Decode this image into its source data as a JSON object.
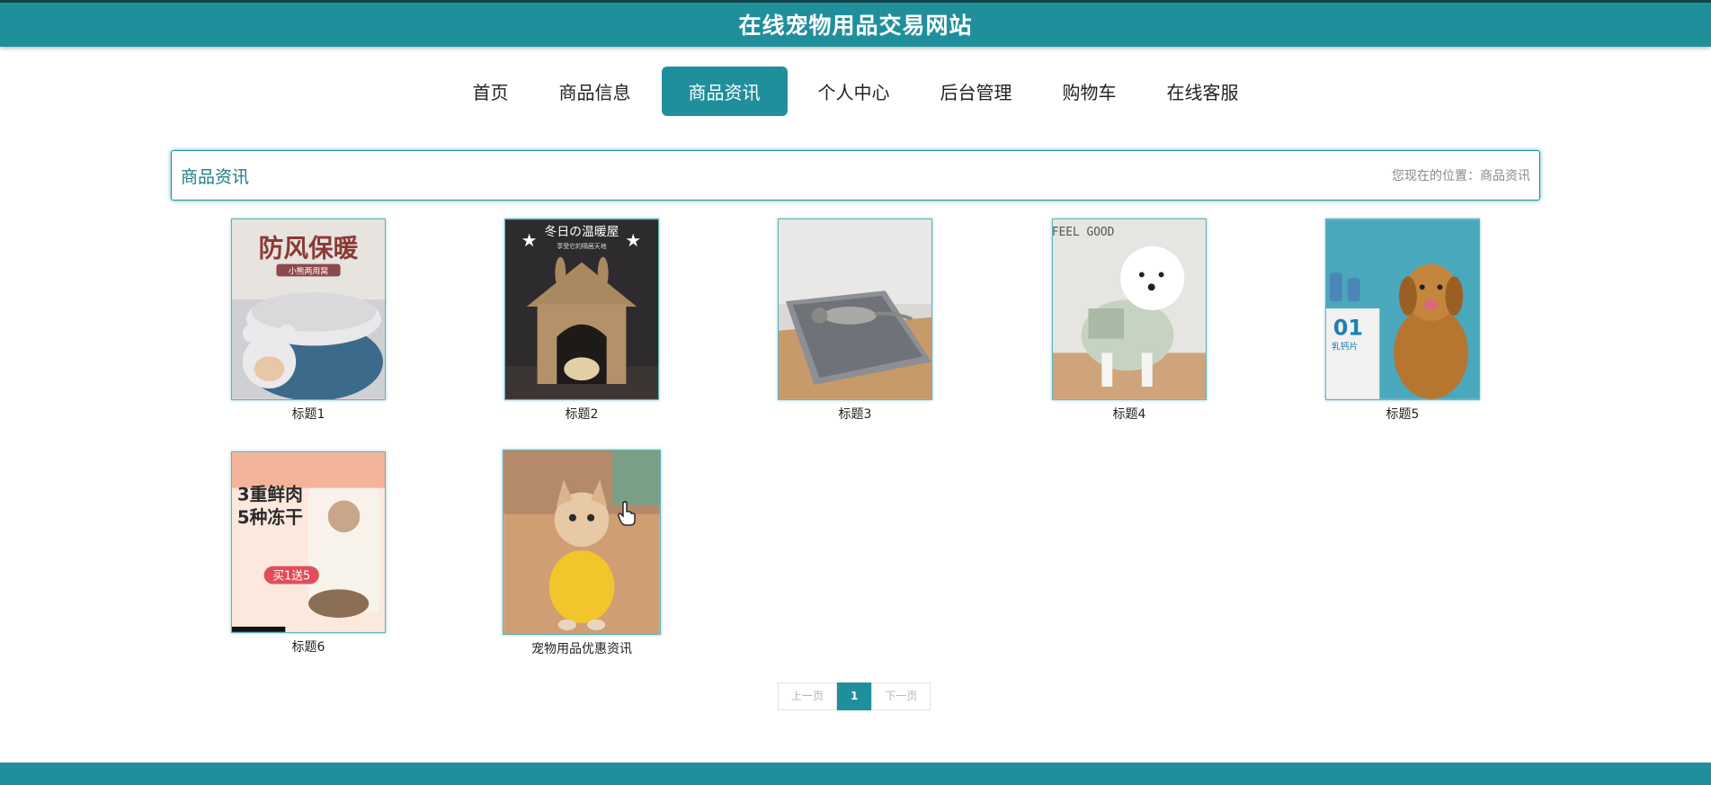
{
  "header": {
    "title": "在线宠物用品交易网站"
  },
  "nav": {
    "items": [
      {
        "label": "首页"
      },
      {
        "label": "商品信息"
      },
      {
        "label": "商品资讯",
        "active": true
      },
      {
        "label": "个人中心"
      },
      {
        "label": "后台管理"
      },
      {
        "label": "购物车"
      },
      {
        "label": "在线客服"
      }
    ]
  },
  "breadcrumb": {
    "title": "商品资讯",
    "location": "您现在的位置：商品资讯"
  },
  "news": [
    {
      "caption": "标题1",
      "image_text": "防风保暖",
      "image_sub": "小熊两用窝"
    },
    {
      "caption": "标题2",
      "image_text": "冬日の温暖屋",
      "image_sub": "享受它的隔居天地"
    },
    {
      "caption": "标题3"
    },
    {
      "caption": "标题4",
      "image_text": "FEEL GOOD"
    },
    {
      "caption": "标题5",
      "image_text": "01",
      "image_sub": "乳钙片"
    },
    {
      "caption": "标题6",
      "image_text": "3重鲜肉\n5种冻干",
      "image_sub": "买1送5"
    },
    {
      "caption": "宠物用品优惠资讯"
    }
  ],
  "pagination": {
    "prev": "上一页",
    "current": "1",
    "next": "下一页"
  },
  "colors": {
    "primary": "#208f9c",
    "dark": "#11434a"
  }
}
